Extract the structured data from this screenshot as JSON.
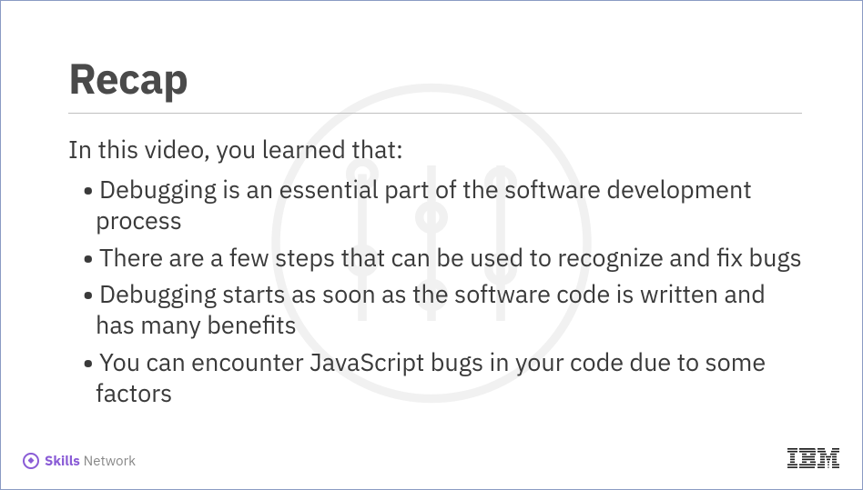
{
  "slide": {
    "title": "Recap",
    "intro": "In this video, you learned that:",
    "bullets": [
      "Debugging is an essential part of the software development process",
      "There are a few steps that can be used to recognize and fix bugs",
      "Debugging starts as soon as the software code is written and has many benefits",
      "You can encounter JavaScript bugs in your code due to some factors"
    ]
  },
  "footer": {
    "brand_primary": "Skills",
    "brand_secondary": "Network",
    "company": "IBM"
  }
}
